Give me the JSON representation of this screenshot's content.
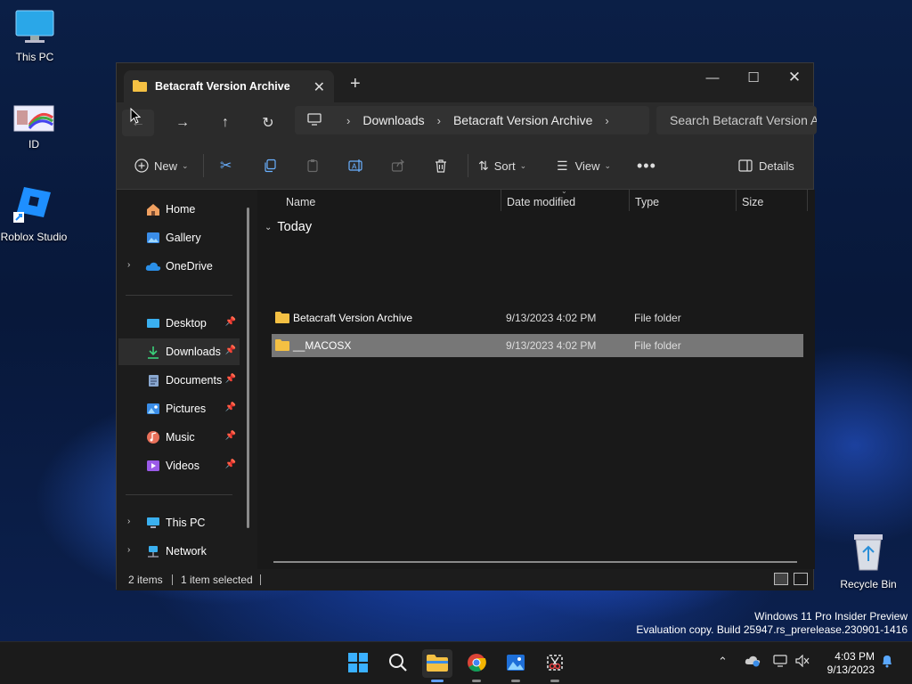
{
  "desktop": {
    "icons": [
      {
        "label": "This PC"
      },
      {
        "label": "ID"
      },
      {
        "label": "Roblox Studio"
      },
      {
        "label": "Recycle Bin"
      }
    ],
    "watermark_line1": "Windows 11 Pro Insider Preview",
    "watermark_line2": "Evaluation copy. Build 25947.rs_prerelease.230901-1416"
  },
  "window": {
    "tab_title": "Betacraft Version Archive",
    "address": {
      "crumbs": [
        "Downloads",
        "Betacraft Version Archive"
      ]
    },
    "search": {
      "placeholder": "Search Betacraft Version Archive"
    },
    "toolbar": {
      "new_label": "New",
      "sort_label": "Sort",
      "view_label": "View",
      "details_label": "Details"
    },
    "sidebar": {
      "items": [
        {
          "label": "Home",
          "icon": "home-icon"
        },
        {
          "label": "Gallery",
          "icon": "gallery-icon"
        },
        {
          "label": "OneDrive",
          "icon": "cloud-icon"
        },
        {
          "label": "Desktop",
          "icon": "desktop-icon"
        },
        {
          "label": "Downloads",
          "icon": "download-icon"
        },
        {
          "label": "Documents",
          "icon": "document-icon"
        },
        {
          "label": "Pictures",
          "icon": "pictures-icon"
        },
        {
          "label": "Music",
          "icon": "music-icon"
        },
        {
          "label": "Videos",
          "icon": "videos-icon"
        },
        {
          "label": "This PC",
          "icon": "computer-icon"
        },
        {
          "label": "Network",
          "icon": "network-icon"
        }
      ]
    },
    "columns": [
      "Name",
      "Date modified",
      "Type",
      "Size"
    ],
    "group_label": "Today",
    "files": [
      {
        "name": "Betacraft Version Archive",
        "date": "9/13/2023 4:02 PM",
        "type": "File folder",
        "size": "",
        "selected": false
      },
      {
        "name": "__MACOSX",
        "date": "9/13/2023 4:02 PM",
        "type": "File folder",
        "size": "",
        "selected": true
      }
    ],
    "status": {
      "items": "2 items",
      "selected": "1 item selected"
    }
  },
  "taskbar": {
    "apps": [
      "start",
      "search",
      "file-explorer",
      "chrome",
      "photos",
      "snipping-tool"
    ],
    "clock_time": "4:03 PM",
    "clock_date": "9/13/2023"
  },
  "colors": {
    "accent": "#60a0ff",
    "folder": "#f4c043",
    "selection": "#777777"
  }
}
